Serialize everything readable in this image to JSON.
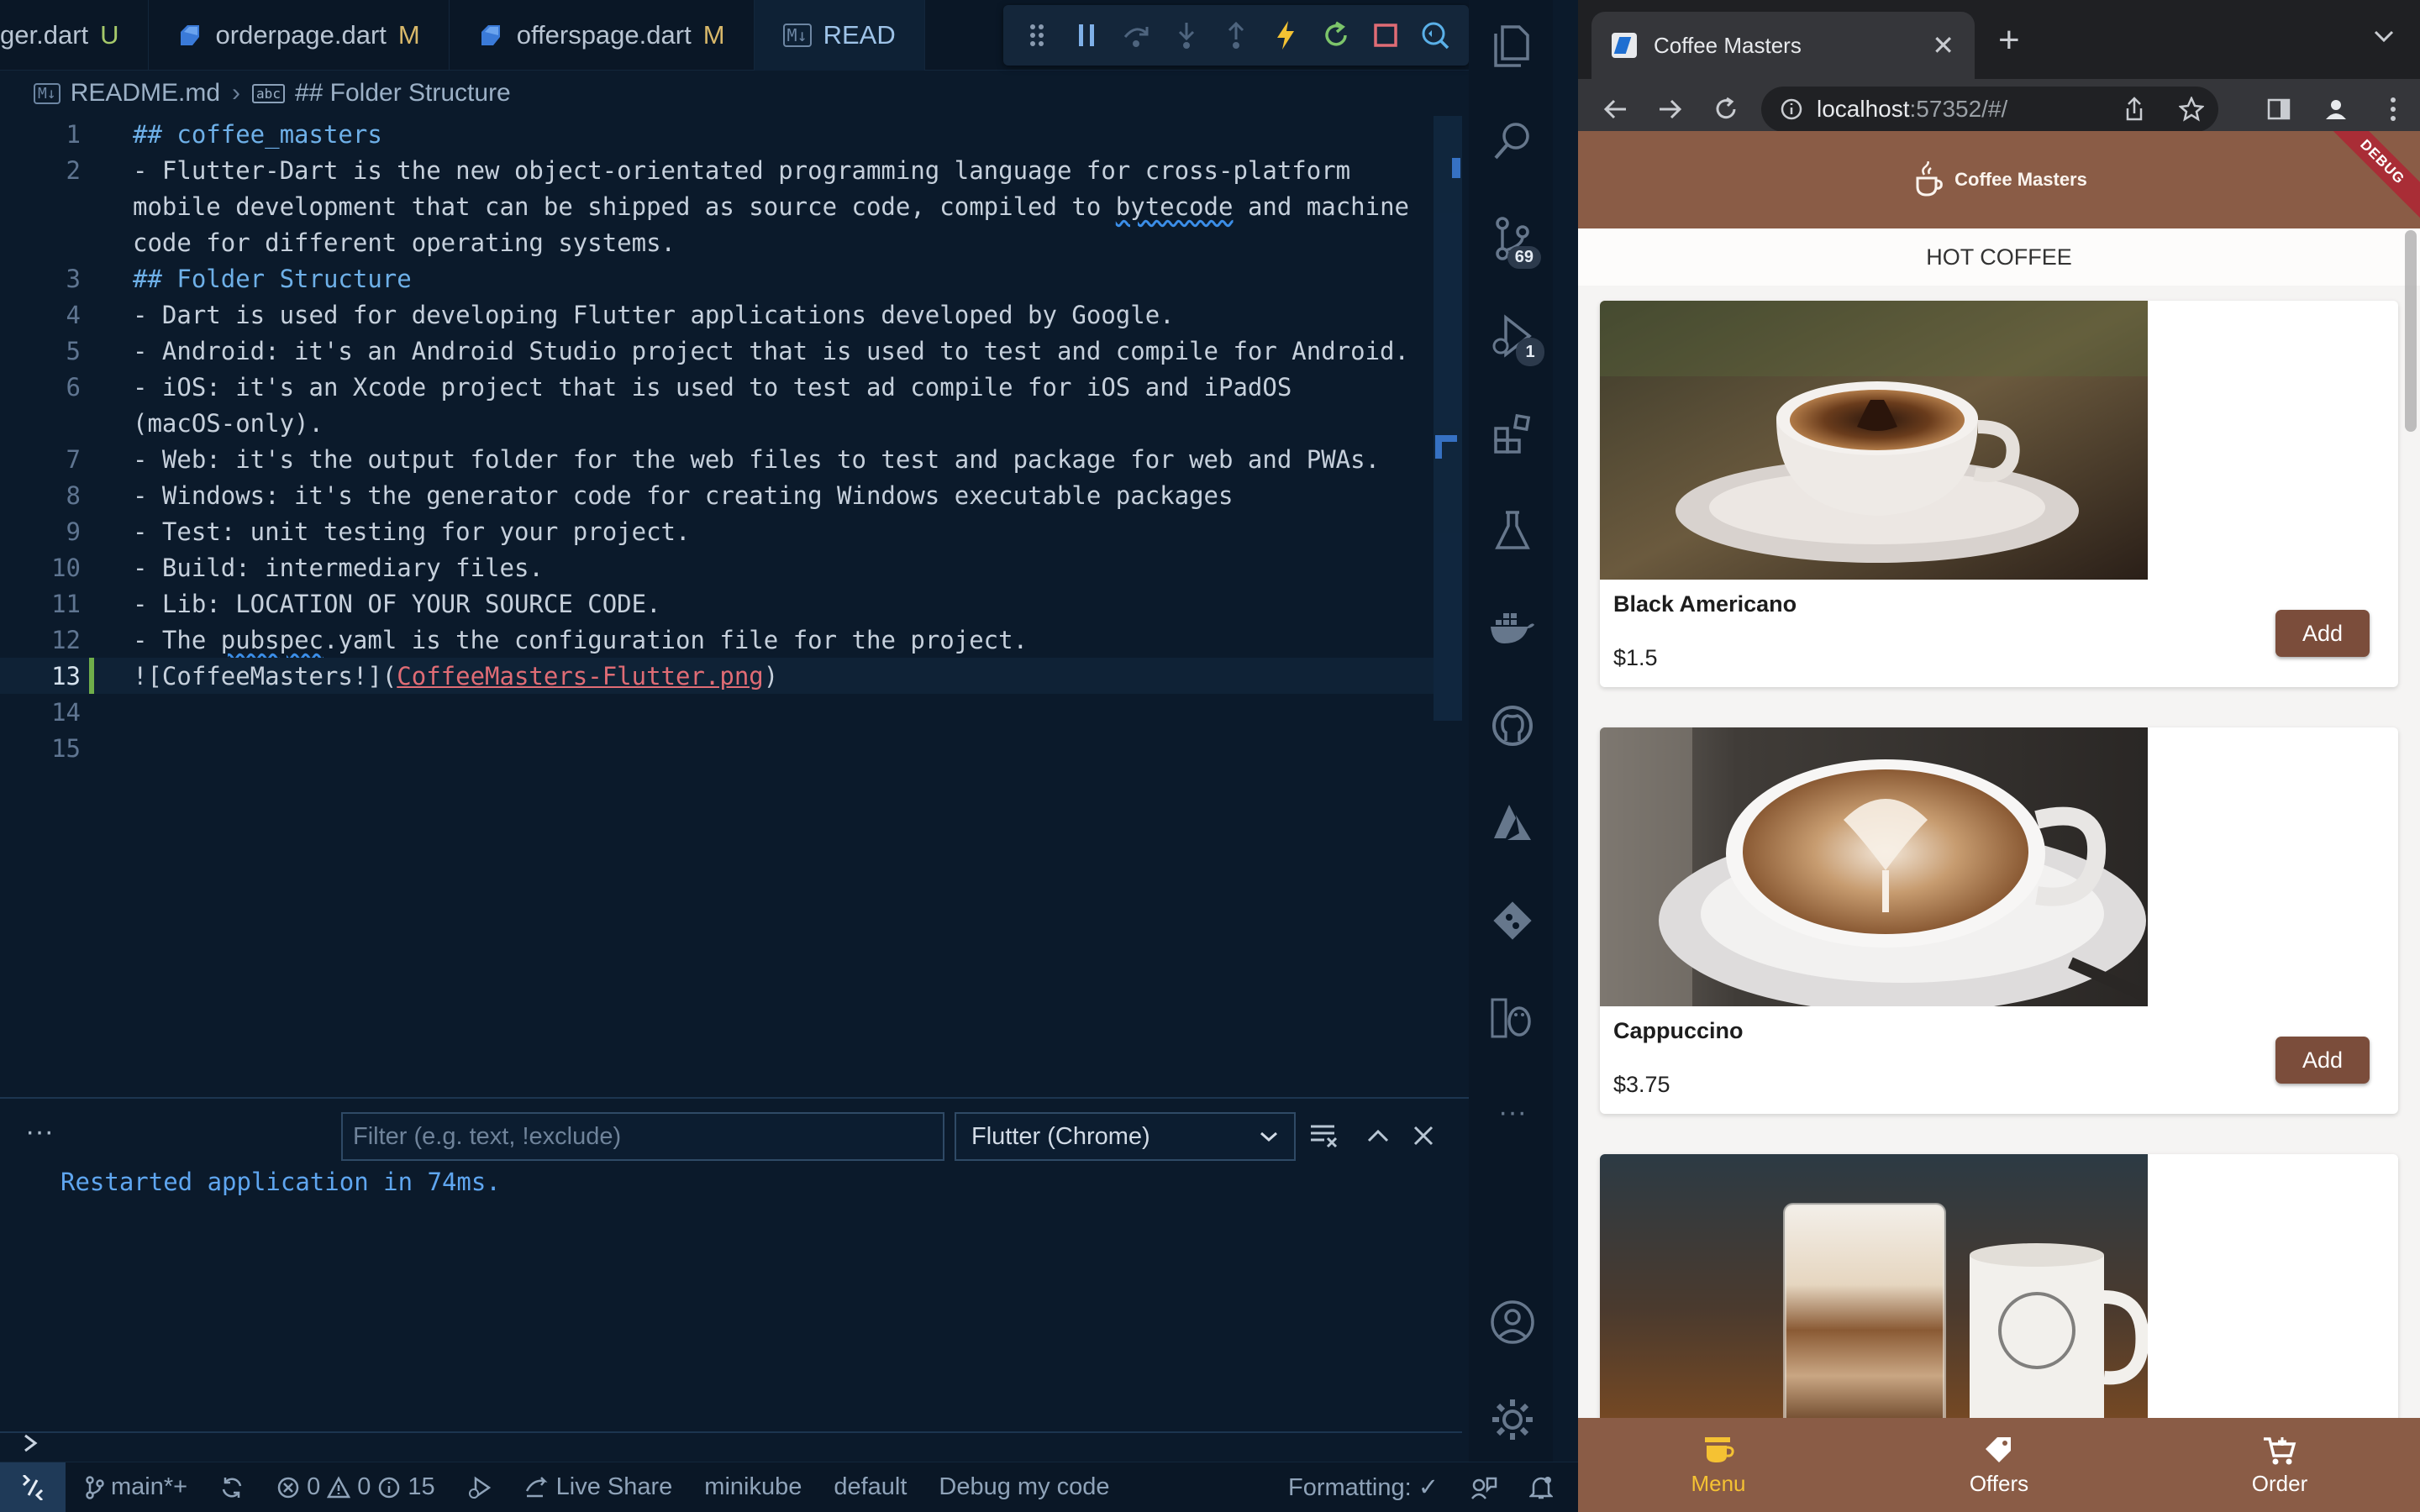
{
  "editor_tabs": [
    {
      "name": "ger.dart",
      "status": "U",
      "kind": "dart",
      "active": false
    },
    {
      "name": "orderpage.dart",
      "status": "M",
      "kind": "dart",
      "active": false
    },
    {
      "name": "offerspage.dart",
      "status": "M",
      "kind": "dart",
      "active": false
    },
    {
      "name": "READ",
      "status": "",
      "kind": "markdown",
      "active": true
    }
  ],
  "debug_toolbar": [
    "drag-handle-icon",
    "pause-icon",
    "step-over-icon",
    "step-into-icon",
    "step-out-icon",
    "hot-reload-icon",
    "restart-icon",
    "stop-icon",
    "inspect-icon"
  ],
  "breadcrumb": {
    "file": "README.md",
    "symbol": "## Folder Structure"
  },
  "editor": {
    "lines": [
      {
        "num": "1",
        "text": "## coffee_masters",
        "heading": true
      },
      {
        "num": "2",
        "text": "- Flutter-Dart is the new object-orientated programming language for cross-platform",
        "heading": false
      },
      {
        "num": "",
        "text": "mobile development that can be shipped as source code, compiled to bytecode and machine",
        "heading": false
      },
      {
        "num": "",
        "text": "code for different operating systems.",
        "heading": false
      },
      {
        "num": "3",
        "text": "## Folder Structure",
        "heading": true
      },
      {
        "num": "4",
        "text": "- Dart is used for developing Flutter applications developed by Google.",
        "heading": false
      },
      {
        "num": "5",
        "text": "- Android: it's an Android Studio project that is used to test and compile for Android.",
        "heading": false
      },
      {
        "num": "6",
        "text": "- iOS: it's an Xcode project that is used to test ad compile for iOS and iPadOS",
        "heading": false
      },
      {
        "num": "",
        "text": "(macOS-only).",
        "heading": false
      },
      {
        "num": "7",
        "text": "- Web: it's the output folder for the web files to test and package for web and PWAs.",
        "heading": false
      },
      {
        "num": "8",
        "text": "- Windows: it's the generator code for creating Windows executable packages",
        "heading": false
      },
      {
        "num": "9",
        "text": "- Test: unit testing for your project.",
        "heading": false
      },
      {
        "num": "10",
        "text": "- Build: intermediary files.",
        "heading": false
      },
      {
        "num": "11",
        "text": "- Lib: LOCATION OF YOUR SOURCE CODE.",
        "heading": false
      },
      {
        "num": "12",
        "text": "- The pubspec.yaml is the configuration file for the project.",
        "heading": false
      },
      {
        "num": "13",
        "text": "![CoffeeMasters!](",
        "heading": false,
        "link": "CoffeeMasters-Flutter.png",
        "tail": ")",
        "current": true
      },
      {
        "num": "14",
        "text": "",
        "heading": false
      },
      {
        "num": "15",
        "text": "",
        "heading": false
      }
    ]
  },
  "panel": {
    "more": "···",
    "filter_placeholder": "Filter (e.g. text, !exclude)",
    "filter_value": "",
    "session": "Flutter (Chrome)",
    "output": "Restarted application in 74ms."
  },
  "activity_bar": {
    "source_control_badge": "69",
    "run_debug_badge": "1",
    "more": "···"
  },
  "statusbar": {
    "branch": "main*+",
    "errors": "0",
    "warnings": "0",
    "info": "15",
    "live_share": "Live Share",
    "minikube": "minikube",
    "namespace": "default",
    "debug_mode": "Debug my code",
    "formatting": "Formatting: ✓"
  },
  "browser": {
    "tab_title": "Coffee Masters",
    "url_host": "localhost",
    "url_path": ":57352/#/",
    "new_tab": "+"
  },
  "app": {
    "brand": "Coffee Masters",
    "debug_banner": "DEBUG",
    "section": "HOT COFFEE",
    "products": [
      {
        "name": "Black Americano",
        "price": "$1.5",
        "button": "Add"
      },
      {
        "name": "Cappuccino",
        "price": "$3.75",
        "button": "Add"
      }
    ],
    "nav": [
      {
        "label": "Menu",
        "icon": "coffee-cup-icon",
        "active": true
      },
      {
        "label": "Offers",
        "icon": "tag-icon",
        "active": false
      },
      {
        "label": "Order",
        "icon": "cart-icon",
        "active": false
      }
    ],
    "colors": {
      "primary": "#8a5c46",
      "button": "#7b4d3b",
      "active_nav": "#f5c233"
    }
  }
}
